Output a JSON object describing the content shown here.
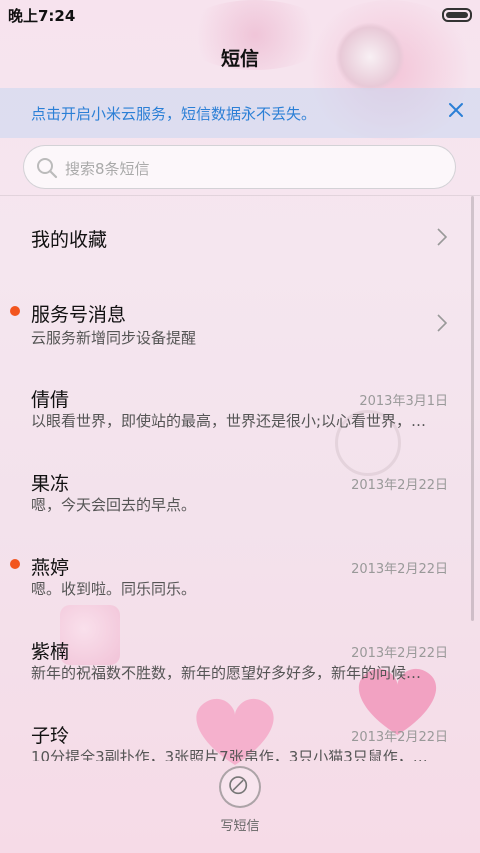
{
  "status": {
    "time": "晚上7:24"
  },
  "header": {
    "title": "短信"
  },
  "banner": {
    "text": "点击开启小米云服务，短信数据永不丢失。"
  },
  "search": {
    "placeholder": "搜索8条短信"
  },
  "conversations": [
    {
      "name": "我的收藏",
      "sub": "",
      "date": "",
      "unread": false,
      "chevron": true
    },
    {
      "name": "服务号消息",
      "sub": "云服务新增同步设备提醒",
      "date": "",
      "unread": true,
      "chevron": true
    },
    {
      "name": "倩倩",
      "sub": "以眼看世界，即使站的最高，世界还是很小;以心看世界，…",
      "date": "2013年3月1日",
      "unread": false,
      "chevron": false
    },
    {
      "name": "果冻",
      "sub": "嗯，今天会回去的早点。",
      "date": "2013年2月22日",
      "unread": false,
      "chevron": false
    },
    {
      "name": "燕婷",
      "sub": "嗯。收到啦。同乐同乐。",
      "date": "2013年2月22日",
      "unread": true,
      "chevron": false
    },
    {
      "name": "紫楠",
      "sub": "新年的祝福数不胜数，新年的愿望好多好多，新年的问候…",
      "date": "2013年2月22日",
      "unread": false,
      "chevron": false
    },
    {
      "name": "子玲",
      "sub": "10分提全3副扑作，3张照片7张帛作，3只小猫3只鼠作，…",
      "date": "2013年2月22日",
      "unread": false,
      "chevron": false
    }
  ],
  "compose": {
    "label": "写短信"
  },
  "colors": {
    "accent": "#2b7fd6",
    "unread_dot": "#f2551e"
  }
}
